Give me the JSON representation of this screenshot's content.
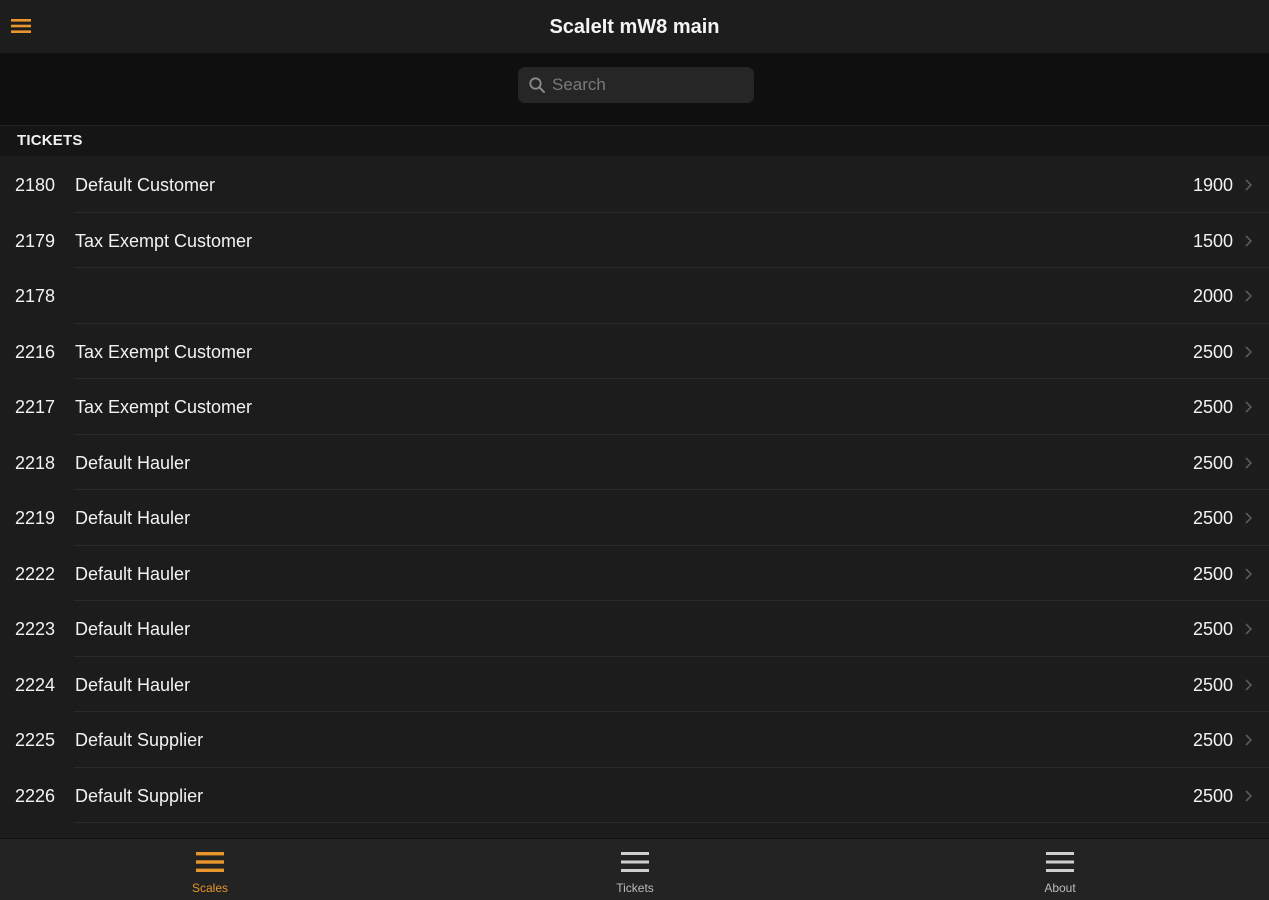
{
  "header": {
    "title": "ScaleIt mW8 main",
    "menu_icon": "hamburger-menu-icon",
    "accent_color": "#e9962c"
  },
  "search": {
    "placeholder": "Search",
    "value": ""
  },
  "section": {
    "title": "TICKETS"
  },
  "tickets": [
    {
      "id": "2180",
      "name": "Default Customer",
      "weight": "1900"
    },
    {
      "id": "2179",
      "name": "Tax Exempt Customer",
      "weight": "1500"
    },
    {
      "id": "2178",
      "name": "",
      "weight": "2000"
    },
    {
      "id": "2216",
      "name": "Tax Exempt Customer",
      "weight": "2500"
    },
    {
      "id": "2217",
      "name": "Tax Exempt Customer",
      "weight": "2500"
    },
    {
      "id": "2218",
      "name": "Default Hauler",
      "weight": "2500"
    },
    {
      "id": "2219",
      "name": "Default Hauler",
      "weight": "2500"
    },
    {
      "id": "2222",
      "name": "Default Hauler",
      "weight": "2500"
    },
    {
      "id": "2223",
      "name": "Default Hauler",
      "weight": "2500"
    },
    {
      "id": "2224",
      "name": "Default Hauler",
      "weight": "2500"
    },
    {
      "id": "2225",
      "name": "Default Supplier",
      "weight": "2500"
    },
    {
      "id": "2226",
      "name": "Default Supplier",
      "weight": "2500"
    }
  ],
  "tabs": [
    {
      "label": "Scales",
      "icon": "list-icon",
      "active": true
    },
    {
      "label": "Tickets",
      "icon": "list-icon",
      "active": false
    },
    {
      "label": "About",
      "icon": "list-icon",
      "active": false
    }
  ]
}
